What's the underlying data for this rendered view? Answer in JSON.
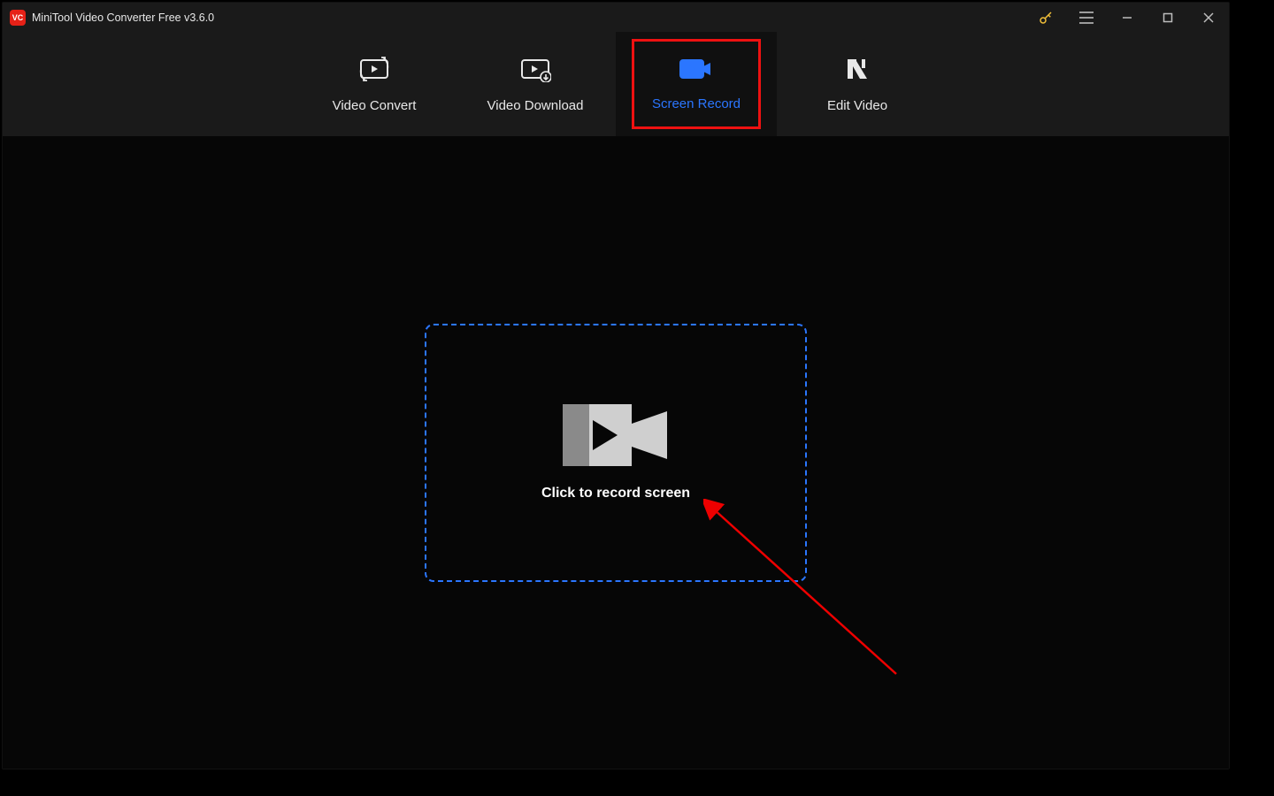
{
  "titlebar": {
    "app_name": "MiniTool Video Converter Free v3.6.0",
    "logo_text": "VC"
  },
  "nav": {
    "items": [
      {
        "id": "video-convert",
        "label": "Video Convert",
        "active": false
      },
      {
        "id": "video-download",
        "label": "Video Download",
        "active": false
      },
      {
        "id": "screen-record",
        "label": "Screen Record",
        "active": true,
        "highlighted": true
      },
      {
        "id": "edit-video",
        "label": "Edit Video",
        "active": false
      }
    ]
  },
  "main": {
    "record_prompt": "Click to record screen"
  },
  "annotations": {
    "arrow_to_record_box": true
  }
}
